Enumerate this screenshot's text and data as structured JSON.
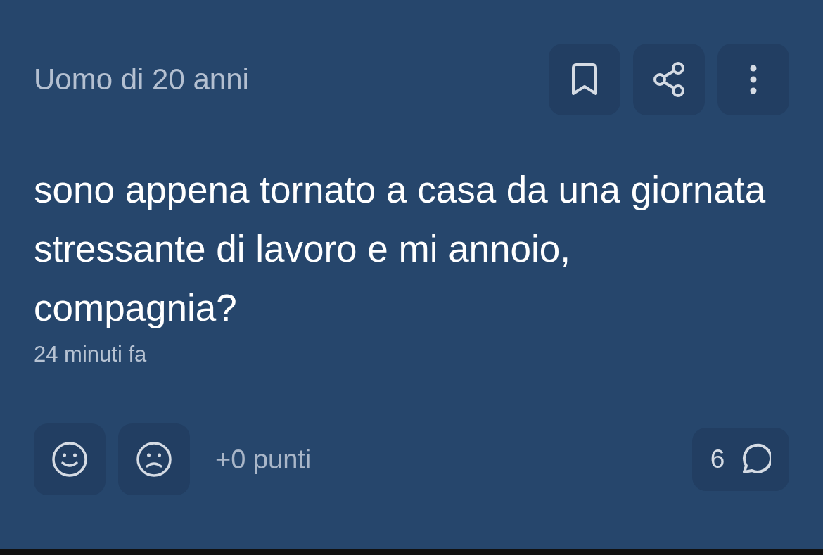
{
  "post": {
    "author": "Uomo di 20 anni",
    "text": "sono appena tornato a casa da una giornata stressante di lavoro e mi annoio, compagnia?",
    "time": "24 minuti fa",
    "points": "+0 punti",
    "comments": "6"
  }
}
